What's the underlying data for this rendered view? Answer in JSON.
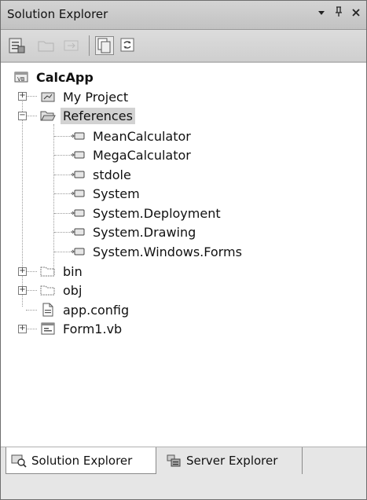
{
  "window": {
    "title": "Solution Explorer",
    "buttons": {
      "dropdown": "▾",
      "pin": "ᵾ",
      "close": "×"
    }
  },
  "toolbar": {
    "buttons": [
      "properties",
      "new-folder",
      "nest-items",
      "show-all-files",
      "refresh"
    ]
  },
  "tree": {
    "root": "CalcApp",
    "my_project": "My Project",
    "references": "References",
    "reference_items": [
      "MeanCalculator",
      "MegaCalculator",
      "stdole",
      "System",
      "System.Deployment",
      "System.Drawing",
      "System.Windows.Forms"
    ],
    "bin": "bin",
    "obj": "obj",
    "app_config": "app.config",
    "form1": "Form1.vb"
  },
  "tabs": {
    "solution_explorer": "Solution Explorer",
    "server_explorer": "Server Explorer"
  }
}
